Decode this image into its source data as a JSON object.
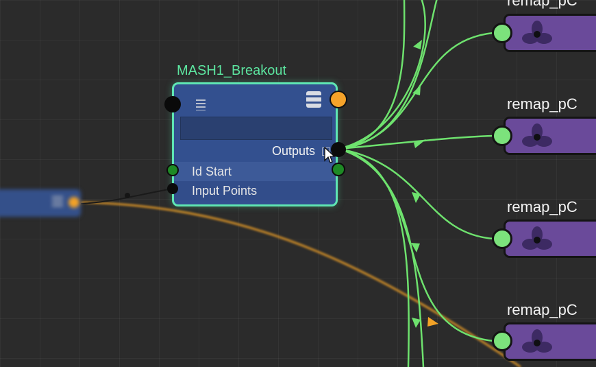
{
  "app": {
    "view": "Node Editor"
  },
  "main_node": {
    "title": "MASH1_Breakout",
    "outputs_label": "Outputs",
    "attributes": [
      {
        "label": "Id Start"
      },
      {
        "label": "Input Points"
      }
    ]
  },
  "remap_nodes": [
    {
      "label": "remap_pC"
    },
    {
      "label": "remap_pC"
    },
    {
      "label": "remap_pC"
    },
    {
      "label": "remap_pC"
    }
  ],
  "colors": {
    "background": "#2b2b2b",
    "node_body": "#33508f",
    "node_selected_border": "#5fe6b3",
    "title_text": "#5ce6a0",
    "connection_green": "#6ee26e",
    "connection_orange": "#f2a227",
    "remap_body": "#6a4a9a",
    "port_green": "#7ce27c",
    "port_orange": "#f5a32a"
  },
  "icons": [
    "list-icon",
    "stack-icon",
    "mouse-cursor-icon",
    "remap-node-icon"
  ]
}
